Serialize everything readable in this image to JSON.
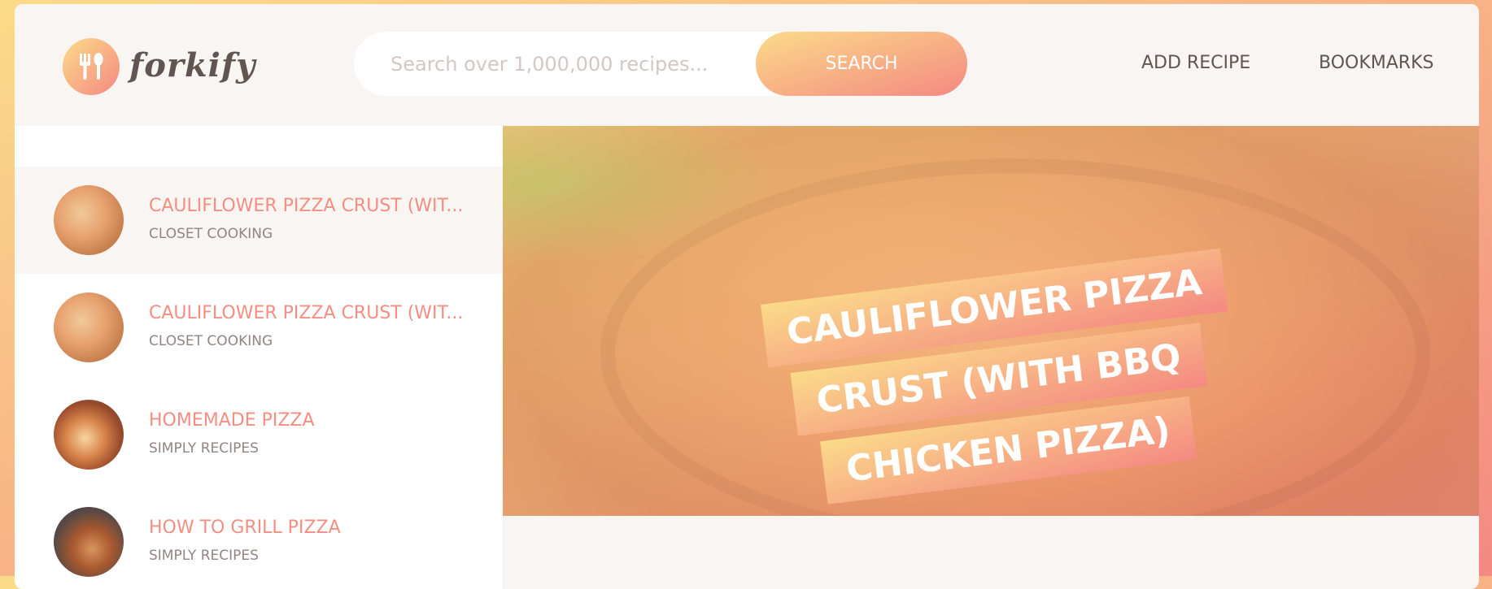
{
  "header": {
    "logo_text": "forkify",
    "search": {
      "placeholder": "Search over 1,000,000 recipes...",
      "value": "",
      "button_label": "SEARCH"
    },
    "nav": {
      "add_recipe": "ADD RECIPE",
      "bookmarks": "BOOKMARKS"
    }
  },
  "results": [
    {
      "title": "CAULIFLOWER PIZZA CRUST (WIT...",
      "publisher": "CLOSET COOKING",
      "active": true
    },
    {
      "title": "CAULIFLOWER PIZZA CRUST (WIT...",
      "publisher": "CLOSET COOKING",
      "active": false
    },
    {
      "title": "HOMEMADE PIZZA",
      "publisher": "SIMPLY RECIPES",
      "active": false
    },
    {
      "title": "HOW TO GRILL PIZZA",
      "publisher": "SIMPLY RECIPES",
      "active": false
    }
  ],
  "recipe": {
    "title_lines": [
      "CAULIFLOWER PIZZA",
      "CRUST (WITH BBQ",
      "CHICKEN PIZZA)"
    ]
  },
  "colors": {
    "gradient_start": "#fbdb89",
    "gradient_end": "#f48982",
    "accent_text": "#f38e82",
    "dark_text": "#615551",
    "muted_text": "#918581"
  },
  "icons": {
    "logo": "fork-spoon-icon"
  }
}
